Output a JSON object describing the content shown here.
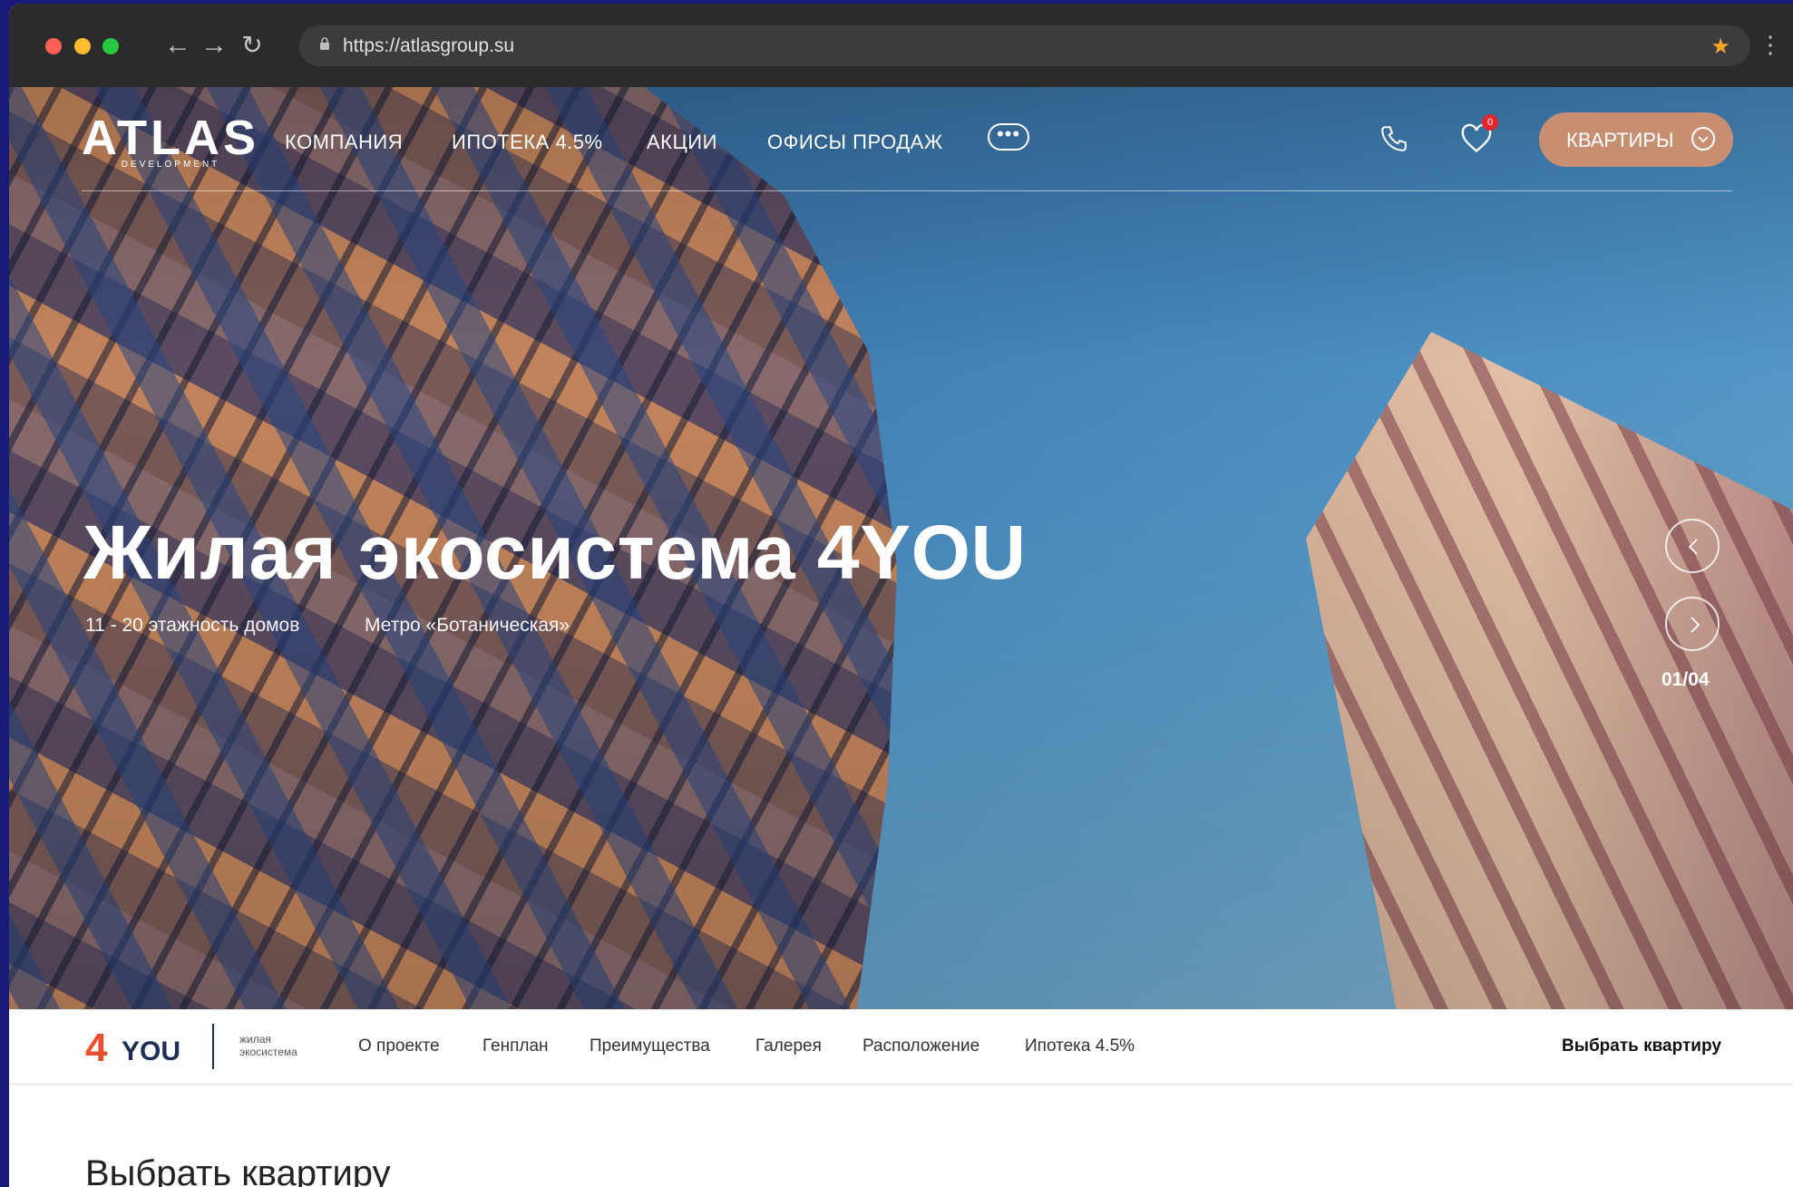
{
  "browser": {
    "url": "https://atlasgroup.su"
  },
  "header": {
    "logo_text": "ATLAS",
    "logo_sub": "DEVELOPMENT",
    "menu": [
      "КОМПАНИЯ",
      "ИПОТЕКА 4.5%",
      "АКЦИИ",
      "ОФИСЫ ПРОДАЖ"
    ],
    "more_label": "•••",
    "favorites_count": "0",
    "apartments_button": "КВАРТИРЫ"
  },
  "hero": {
    "title": "Жилая экосистема 4YOU",
    "subtitle_1": "11 - 20 этажность домов",
    "subtitle_2": "Метро «Ботаническая»",
    "counter": "01/04"
  },
  "subnav": {
    "brand_num": "4",
    "brand_word": "YOU",
    "brand_tagline": "жилая экосистема",
    "items": [
      "О проекте",
      "Генплан",
      "Преимущества",
      "Галерея",
      "Расположение",
      "Ипотека 4.5%"
    ],
    "cta": "Выбрать квартиру"
  },
  "section": {
    "title": "Выбрать квартиру"
  },
  "colors": {
    "accent_button": "#c88e72",
    "brand_orange": "#e84f2e",
    "brand_navy": "#1d2f57",
    "badge_red": "#e2242b"
  }
}
